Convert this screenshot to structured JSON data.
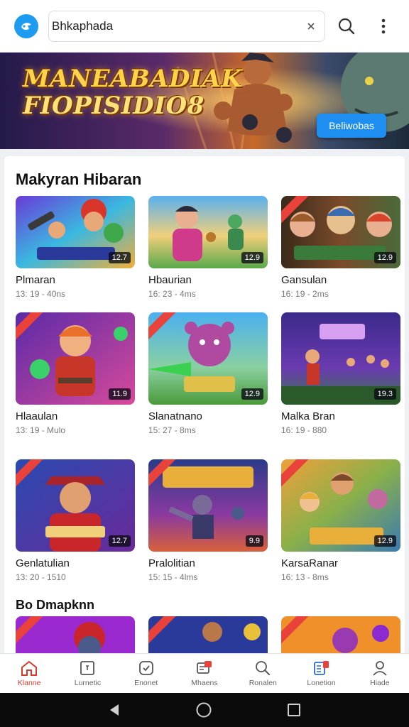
{
  "search": {
    "value": "Bhkaphada",
    "placeholder": ""
  },
  "banner": {
    "title_line1": "MANEABADIAK",
    "title_line2": "FIOPISIDIO8",
    "button_label": "Beliwobas"
  },
  "section": {
    "title": "Makyran Hibaran"
  },
  "cards": [
    {
      "title": "Plmaran",
      "meta": "13: 19 - 40ns",
      "badge": "12.7"
    },
    {
      "title": "Hbaurian",
      "meta": "16: 23 - 4ms",
      "badge": "12.9"
    },
    {
      "title": "Gansulan",
      "meta": "16: 19 - 2ms",
      "badge": "12.9"
    },
    {
      "title": "Hlaaulan",
      "meta": "13: 19 - Mulo",
      "badge": "11.9"
    },
    {
      "title": "Slanatnano",
      "meta": "15: 27 - 8ms",
      "badge": "12.9"
    },
    {
      "title": "Malka Bran",
      "meta": "16: 19 - 880",
      "badge": "19.3"
    },
    {
      "title": "Genlatulian",
      "meta": "13: 20 - 1510",
      "badge": "12.7"
    },
    {
      "title": "Pralolitian",
      "meta": "15: 15 - 4lms",
      "badge": "9.9"
    },
    {
      "title": "KarsaRanar",
      "meta": "16: 13 - 8ms",
      "badge": "12.9"
    }
  ],
  "section2": {
    "title": "Bo Dmapknn"
  },
  "bottom_nav": [
    {
      "label": "Klanne",
      "icon": "home-icon"
    },
    {
      "label": "Lurnetic",
      "icon": "grid-icon"
    },
    {
      "label": "Enonet",
      "icon": "compass-icon"
    },
    {
      "label": "Mhaens",
      "icon": "chat-icon"
    },
    {
      "label": "Ronalen",
      "icon": "search-icon"
    },
    {
      "label": "Lonetion",
      "icon": "library-icon"
    },
    {
      "label": "Hiade",
      "icon": "profile-icon"
    }
  ],
  "colors": {
    "accent": "#1e8ff0",
    "active_nav": "#d83a2c"
  }
}
